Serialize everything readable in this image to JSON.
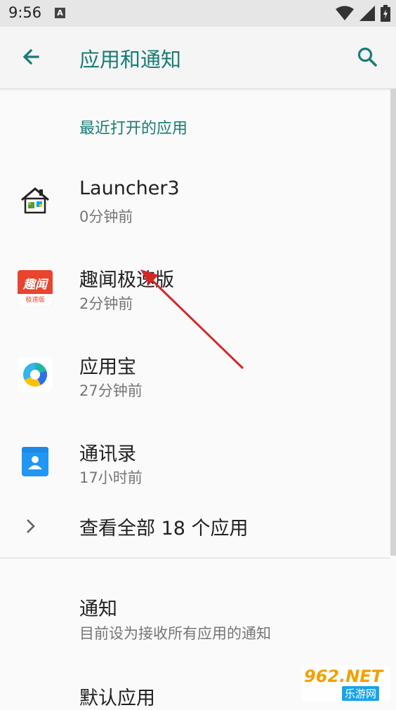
{
  "status": {
    "time": "9:56",
    "a_label": "A"
  },
  "appbar": {
    "title": "应用和通知"
  },
  "recent": {
    "header": "最近打开的应用",
    "apps": [
      {
        "name": "Launcher3",
        "time": "0分钟前",
        "icon": "launcher3-icon"
      },
      {
        "name": "趣闻极速版",
        "time": "2分钟前",
        "icon": "quwen-icon"
      },
      {
        "name": "应用宝",
        "time": "27分钟前",
        "icon": "yingyongbao-icon"
      },
      {
        "name": "通讯录",
        "time": "17小时前",
        "icon": "contacts-icon"
      }
    ],
    "see_all": "查看全部 18 个应用"
  },
  "settings": {
    "notifications": {
      "title": "通知",
      "summary": "目前设为接收所有应用的通知"
    },
    "default_apps": {
      "title": "默认应用"
    }
  },
  "quwen_badge": {
    "main": "趣闻",
    "sub": "极速版"
  },
  "watermark": {
    "main": "962.NET",
    "sub": "乐游网"
  },
  "colors": {
    "accent": "#167d75",
    "quwen_red": "#e8442e",
    "arrow": "#d62728"
  }
}
